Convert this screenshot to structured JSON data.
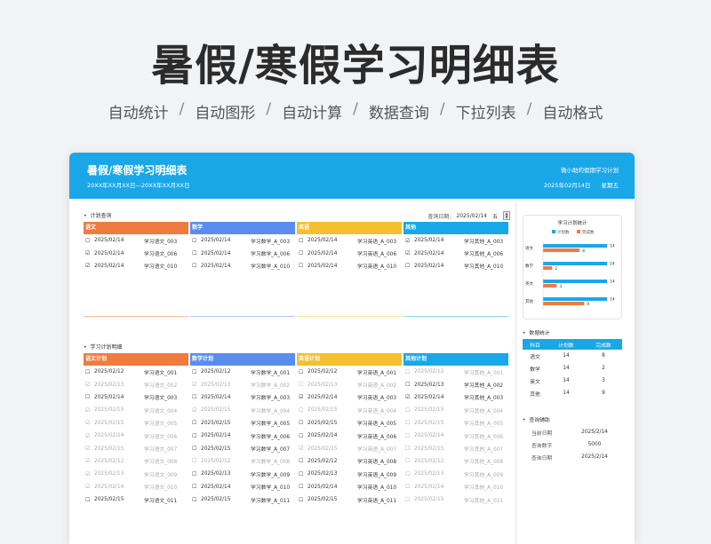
{
  "hero": {
    "title": "暑假/寒假学习明细表",
    "features": [
      "自动统计",
      "自动图形",
      "自动计算",
      "数据查询",
      "下拉列表",
      "自动格式"
    ]
  },
  "banner": {
    "title": "暑假/寒假学习明细表",
    "range": "20XX年XX月XX日—20XX年XX月XX日",
    "plan_owner": "微小助的假期学习计划",
    "date": "2025年02月14日",
    "weekday": "星期五"
  },
  "plan_query": {
    "label": "计划查询",
    "query_label": "查询日期:",
    "query_date": "2025/02/14",
    "query_weekday": "五",
    "columns": [
      {
        "title": "语文",
        "color": "#f07b3f",
        "rows": [
          {
            "check": "☐",
            "date": "2025/02/14",
            "task": "学习语文_003",
            "done": false
          },
          {
            "check": "☑",
            "date": "2025/02/14",
            "task": "学习语文_006",
            "done": false
          },
          {
            "check": "☑",
            "date": "2025/02/14",
            "task": "学习语文_010",
            "done": false
          }
        ]
      },
      {
        "title": "数学",
        "color": "#5b8def",
        "rows": [
          {
            "check": "☐",
            "date": "2025/02/14",
            "task": "学习数学_A_003",
            "done": false
          },
          {
            "check": "☐",
            "date": "2025/02/14",
            "task": "学习数学_A_006",
            "done": false
          },
          {
            "check": "☐",
            "date": "2025/02/14",
            "task": "学习数学_A_010",
            "done": false
          }
        ]
      },
      {
        "title": "英语",
        "color": "#f5c02f",
        "rows": [
          {
            "check": "☐",
            "date": "2025/02/14",
            "task": "学习英语_A_003",
            "done": false
          },
          {
            "check": "☐",
            "date": "2025/02/14",
            "task": "学习英语_A_006",
            "done": false
          },
          {
            "check": "☐",
            "date": "2025/02/14",
            "task": "学习英语_A_010",
            "done": false
          }
        ]
      },
      {
        "title": "其他",
        "color": "#1aa7e8",
        "rows": [
          {
            "check": "☑",
            "date": "2025/02/14",
            "task": "学习其他_A_003",
            "done": false
          },
          {
            "check": "☑",
            "date": "2025/02/14",
            "task": "学习其他_A_006",
            "done": false
          },
          {
            "check": "☐",
            "date": "2025/02/14",
            "task": "学习其他_A_010",
            "done": false
          }
        ]
      }
    ]
  },
  "detail": {
    "label": "学习计划明细",
    "columns": [
      {
        "title": "语文计划",
        "color": "#f07b3f",
        "rows": [
          {
            "check": "☐",
            "date": "2025/02/12",
            "task": "学习语文_001",
            "done": false
          },
          {
            "check": "☑",
            "date": "2025/02/13",
            "task": "学习语文_002",
            "done": true
          },
          {
            "check": "☐",
            "date": "2025/02/14",
            "task": "学习语文_003",
            "done": false
          },
          {
            "check": "☑",
            "date": "2025/02/15",
            "task": "学习语文_004",
            "done": true
          },
          {
            "check": "☑",
            "date": "2025/02/15",
            "task": "学习语文_005",
            "done": true
          },
          {
            "check": "☑",
            "date": "2025/02/14",
            "task": "学习语文_006",
            "done": true
          },
          {
            "check": "☑",
            "date": "2025/02/15",
            "task": "学习语文_007",
            "done": true
          },
          {
            "check": "☑",
            "date": "2025/02/12",
            "task": "学习语文_008",
            "done": true
          },
          {
            "check": "☑",
            "date": "2025/02/13",
            "task": "学习语文_009",
            "done": true
          },
          {
            "check": "☑",
            "date": "2025/02/14",
            "task": "学习语文_010",
            "done": true
          },
          {
            "check": "☐",
            "date": "2025/02/15",
            "task": "学习语文_011",
            "done": false
          }
        ]
      },
      {
        "title": "数学计划",
        "color": "#5b8def",
        "rows": [
          {
            "check": "☐",
            "date": "2025/02/12",
            "task": "学习数学_A_001",
            "done": false
          },
          {
            "check": "☑",
            "date": "2025/02/13",
            "task": "学习数学_A_002",
            "done": true
          },
          {
            "check": "☐",
            "date": "2025/02/14",
            "task": "学习数学_A_003",
            "done": false
          },
          {
            "check": "☑",
            "date": "2025/02/15",
            "task": "学习数学_A_004",
            "done": true
          },
          {
            "check": "☐",
            "date": "2025/02/15",
            "task": "学习数学_A_005",
            "done": false
          },
          {
            "check": "☐",
            "date": "2025/02/14",
            "task": "学习数学_A_006",
            "done": false
          },
          {
            "check": "☐",
            "date": "2025/02/15",
            "task": "学习数学_A_007",
            "done": false
          },
          {
            "check": "☐",
            "date": "2025/02/12",
            "task": "学习数学_A_008",
            "done": true
          },
          {
            "check": "☐",
            "date": "2025/02/13",
            "task": "学习数学_A_009",
            "done": false
          },
          {
            "check": "☐",
            "date": "2025/02/14",
            "task": "学习数学_A_010",
            "done": false
          },
          {
            "check": "☐",
            "date": "2025/02/15",
            "task": "学习数学_A_011",
            "done": false
          }
        ]
      },
      {
        "title": "英语计划",
        "color": "#f5c02f",
        "rows": [
          {
            "check": "☐",
            "date": "2025/02/12",
            "task": "学习英语_A_001",
            "done": false
          },
          {
            "check": "☐",
            "date": "2025/02/13",
            "task": "学习英语_A_002",
            "done": true
          },
          {
            "check": "☑",
            "date": "2025/02/14",
            "task": "学习英语_A_003",
            "done": false
          },
          {
            "check": "☐",
            "date": "2025/02/15",
            "task": "学习英语_A_004",
            "done": true
          },
          {
            "check": "☐",
            "date": "2025/02/15",
            "task": "学习英语_A_005",
            "done": false
          },
          {
            "check": "☐",
            "date": "2025/02/14",
            "task": "学习英语_A_006",
            "done": false
          },
          {
            "check": "☑",
            "date": "2025/02/15",
            "task": "学习英语_A_007",
            "done": true
          },
          {
            "check": "☐",
            "date": "2025/02/12",
            "task": "学习英语_A_008",
            "done": false
          },
          {
            "check": "☐",
            "date": "2025/02/13",
            "task": "学习英语_A_009",
            "done": false
          },
          {
            "check": "☐",
            "date": "2025/02/14",
            "task": "学习英语_A_010",
            "done": false
          },
          {
            "check": "☐",
            "date": "2025/02/15",
            "task": "学习英语_A_011",
            "done": false
          }
        ]
      },
      {
        "title": "其他计划",
        "color": "#1aa7e8",
        "rows": [
          {
            "check": "☐",
            "date": "2025/02/12",
            "task": "学习其他_A_001",
            "done": true
          },
          {
            "check": "☐",
            "date": "2025/02/13",
            "task": "学习其他_A_002",
            "done": false
          },
          {
            "check": "☑",
            "date": "2025/02/14",
            "task": "学习其他_A_003",
            "done": false
          },
          {
            "check": "☐",
            "date": "2025/02/15",
            "task": "学习其他_A_004",
            "done": true
          },
          {
            "check": "☐",
            "date": "2025/02/15",
            "task": "学习其他_A_005",
            "done": true
          },
          {
            "check": "☐",
            "date": "2025/02/14",
            "task": "学习其他_A_006",
            "done": true
          },
          {
            "check": "☐",
            "date": "2025/02/15",
            "task": "学习其他_A_007",
            "done": true
          },
          {
            "check": "☐",
            "date": "2025/02/12",
            "task": "学习其他_A_008",
            "done": true
          },
          {
            "check": "☐",
            "date": "2025/02/13",
            "task": "学习其他_A_009",
            "done": true
          },
          {
            "check": "☐",
            "date": "2025/02/14",
            "task": "学习其他_A_010",
            "done": true
          },
          {
            "check": "☐",
            "date": "2025/02/15",
            "task": "学习其他_A_011",
            "done": true
          }
        ]
      }
    ]
  },
  "stats_chart": {
    "title": "学习计划统计",
    "legend": [
      "计划数",
      "完成数"
    ],
    "colors": {
      "plan": "#1aa7e8",
      "done": "#f07b3f"
    }
  },
  "chart_data": {
    "type": "bar",
    "orientation": "horizontal",
    "title": "学习计划统计",
    "categories": [
      "语文",
      "数学",
      "英文",
      "其他"
    ],
    "series": [
      {
        "name": "计划数",
        "values": [
          14,
          14,
          14,
          14
        ]
      },
      {
        "name": "完成数",
        "values": [
          8,
          2,
          3,
          9
        ]
      }
    ],
    "legend": "top"
  },
  "data_stats": {
    "label": "数据统计",
    "headers": [
      "科目",
      "计划数",
      "完成数"
    ],
    "rows": [
      [
        "语文",
        "14",
        "8"
      ],
      [
        "数学",
        "14",
        "2"
      ],
      [
        "英文",
        "14",
        "3"
      ],
      [
        "其他",
        "14",
        "9"
      ]
    ]
  },
  "query_aux": {
    "label": "查询辅助",
    "rows": [
      {
        "k": "当前日期",
        "v": "2025/2/14"
      },
      {
        "k": "查询数字",
        "v": "5000"
      },
      {
        "k": "查询日期",
        "v": "2025/2/14"
      }
    ]
  }
}
